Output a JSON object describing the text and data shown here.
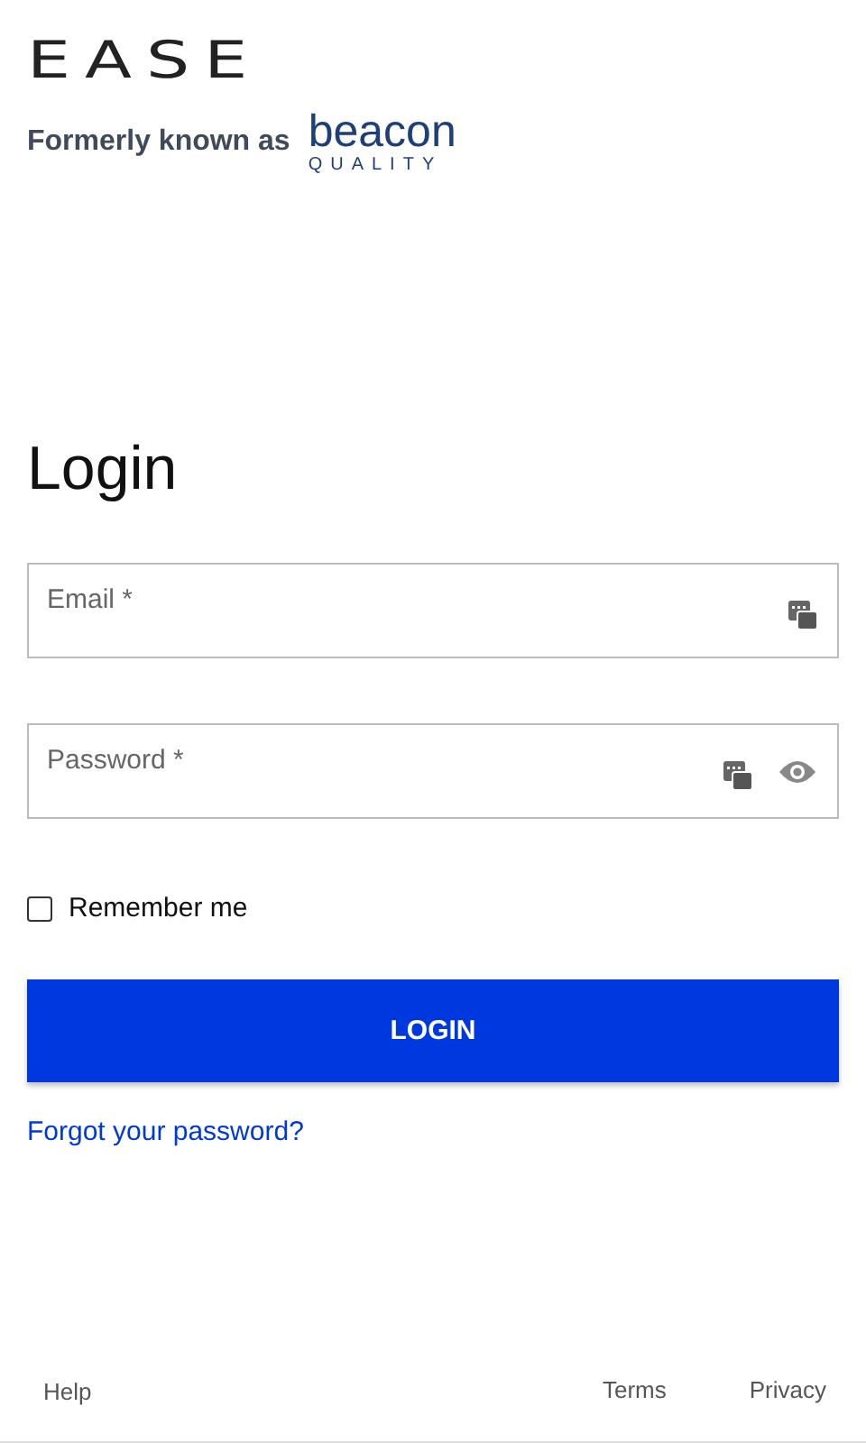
{
  "logo": {
    "name": "EASE"
  },
  "former": {
    "label": "Formerly known as",
    "brand": "beacon",
    "tagline": "QUALITY"
  },
  "title": "Login",
  "fields": [
    {
      "placeholder": "Email *",
      "kind": "email"
    },
    {
      "placeholder": "Password *",
      "kind": "password"
    }
  ],
  "remember": {
    "label": "Remember me",
    "checked": false
  },
  "login_button": "LOGIN",
  "forgot_link": "Forgot your password?",
  "footer": {
    "left": [
      "Help"
    ],
    "right": [
      "Terms",
      "Privacy"
    ]
  }
}
